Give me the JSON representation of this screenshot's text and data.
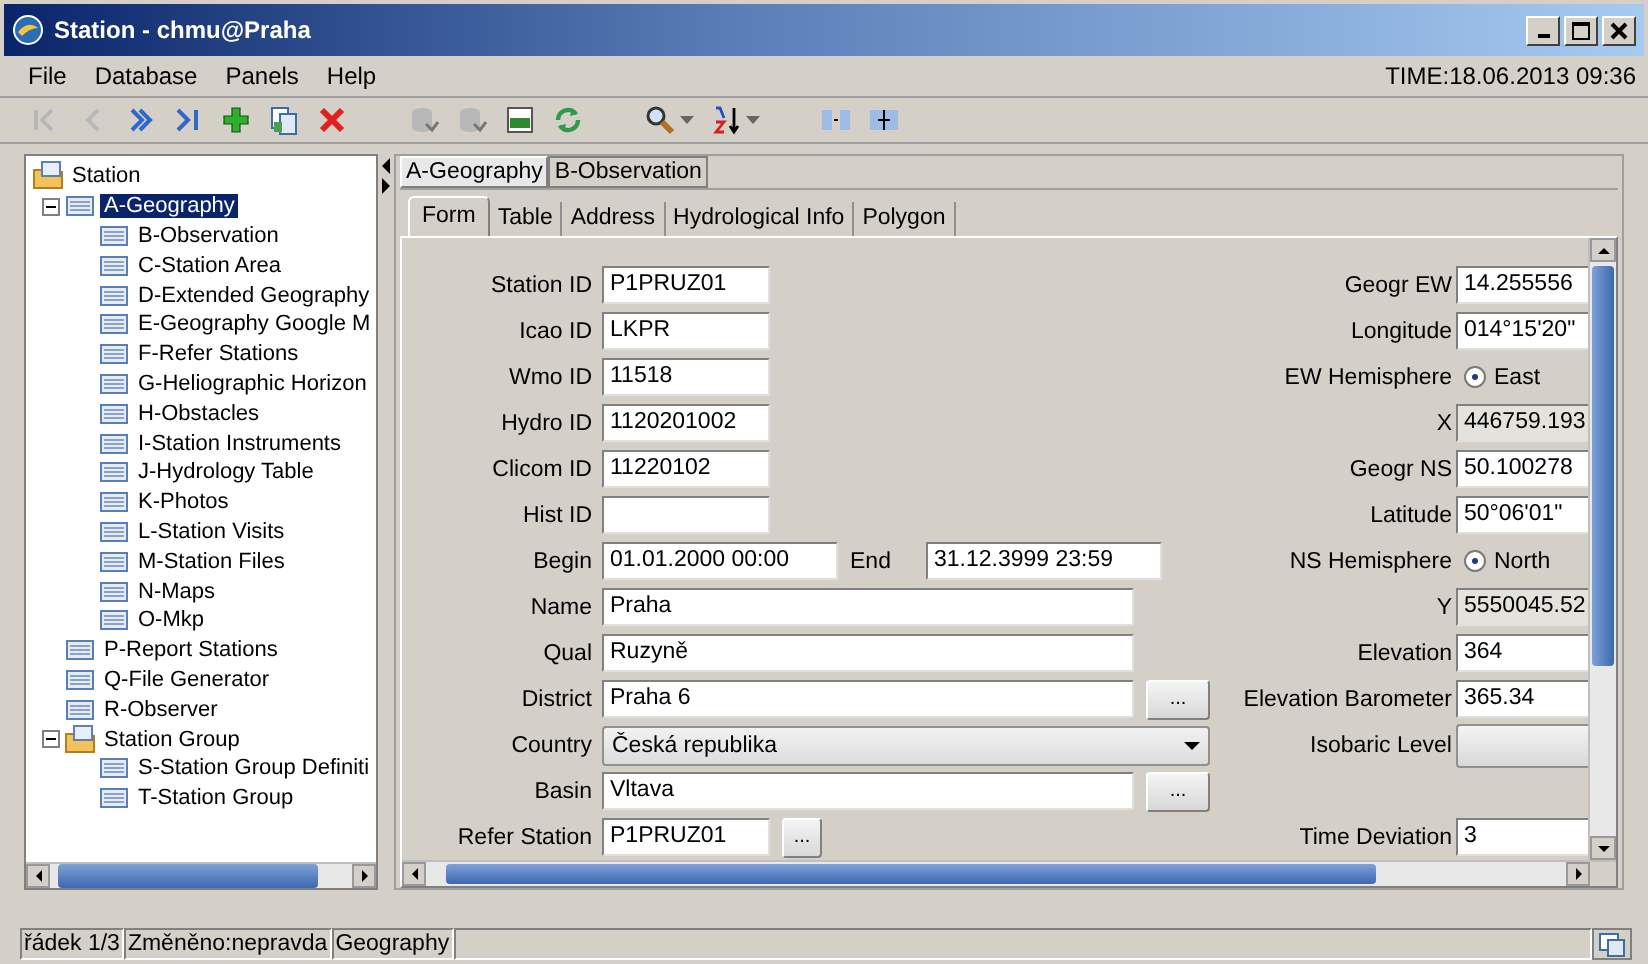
{
  "window": {
    "title": "Station - chmu@Praha"
  },
  "menu": [
    "File",
    "Database",
    "Panels",
    "Help"
  ],
  "time": "TIME:18.06.2013 09:36",
  "toolbar": [
    {
      "kind": "first",
      "disabled": true
    },
    {
      "kind": "prev",
      "disabled": true
    },
    {
      "kind": "next",
      "disabled": false
    },
    {
      "kind": "last",
      "disabled": false
    },
    {
      "kind": "add",
      "disabled": false
    },
    {
      "kind": "copy",
      "disabled": false
    },
    {
      "kind": "delete",
      "disabled": false
    },
    {
      "kind": "sep"
    },
    {
      "kind": "db",
      "disabled": true
    },
    {
      "kind": "db",
      "disabled": true
    },
    {
      "kind": "csv",
      "disabled": false
    },
    {
      "kind": "refresh",
      "disabled": false
    },
    {
      "kind": "sep"
    },
    {
      "kind": "search",
      "disabled": false
    },
    {
      "kind": "sort",
      "disabled": false
    },
    {
      "kind": "sep"
    },
    {
      "kind": "split",
      "disabled": false
    },
    {
      "kind": "join",
      "disabled": false
    }
  ],
  "tree": [
    {
      "label": "Station",
      "kind": "folder",
      "selected": false,
      "children": [
        {
          "label": "A-Geography",
          "kind": "table",
          "selected": true,
          "expanded": true,
          "children": [
            {
              "label": "B-Observation",
              "kind": "table",
              "selected": false
            },
            {
              "label": "C-Station Area",
              "kind": "table",
              "selected": false
            },
            {
              "label": "D-Extended Geography",
              "kind": "table",
              "selected": false
            },
            {
              "label": "E-Geography Google M",
              "kind": "table",
              "selected": false
            },
            {
              "label": "F-Refer Stations",
              "kind": "table",
              "selected": false
            },
            {
              "label": "G-Heliographic Horizon",
              "kind": "table",
              "selected": false
            },
            {
              "label": "H-Obstacles",
              "kind": "table",
              "selected": false
            },
            {
              "label": "I-Station Instruments",
              "kind": "table",
              "selected": false
            },
            {
              "label": "J-Hydrology Table",
              "kind": "table",
              "selected": false
            },
            {
              "label": "K-Photos",
              "kind": "table",
              "selected": false
            },
            {
              "label": "L-Station Visits",
              "kind": "table",
              "selected": false
            },
            {
              "label": "M-Station Files",
              "kind": "table",
              "selected": false
            },
            {
              "label": "N-Maps",
              "kind": "table",
              "selected": false
            },
            {
              "label": "O-Mkp",
              "kind": "table",
              "selected": false
            }
          ]
        },
        {
          "label": "P-Report Stations",
          "kind": "table",
          "selected": false
        },
        {
          "label": "Q-File Generator",
          "kind": "table",
          "selected": false
        },
        {
          "label": "R-Observer",
          "kind": "table",
          "selected": false
        },
        {
          "label": "Station Group",
          "kind": "folder",
          "selected": false,
          "expanded": true,
          "children": [
            {
              "label": "S-Station Group Definiti",
              "kind": "table",
              "selected": false
            },
            {
              "label": "T-Station Group",
              "kind": "table",
              "selected": false
            }
          ]
        }
      ]
    }
  ],
  "panel_tabs": [
    {
      "label": "A-Geography",
      "selected": true
    },
    {
      "label": "B-Observation",
      "selected": false
    }
  ],
  "form_tabs": [
    {
      "label": "Form",
      "selected": true
    },
    {
      "label": "Table",
      "selected": false
    },
    {
      "label": "Address",
      "selected": false
    },
    {
      "label": "Hydrological Info",
      "selected": false
    },
    {
      "label": "Polygon",
      "selected": false
    }
  ],
  "form_left": [
    {
      "kind": "short",
      "label": "Station ID",
      "value": "P1PRUZ01"
    },
    {
      "kind": "short",
      "label": "Icao ID",
      "value": "LKPR"
    },
    {
      "kind": "short",
      "label": "Wmo ID",
      "value": "11518"
    },
    {
      "kind": "short",
      "label": "Hydro ID",
      "value": "1120201002"
    },
    {
      "kind": "short",
      "label": "Clicom ID",
      "value": "11220102"
    },
    {
      "kind": "short",
      "label": "Hist ID"
    },
    {
      "kind": "range",
      "label": "Begin",
      "value": "01.01.2000 00:00",
      "label2": "End",
      "value2": "31.12.3999 23:59"
    },
    {
      "kind": "long",
      "label": "Name",
      "value": "Praha"
    },
    {
      "kind": "long",
      "label": "Qual",
      "value": "Ruzyně"
    },
    {
      "kind": "long",
      "label": "District",
      "value": "Praha 6",
      "button": "..."
    },
    {
      "kind": "select",
      "label": "Country",
      "value": "Česká republika"
    },
    {
      "kind": "long",
      "label": "Basin",
      "value": "Vltava",
      "button": "..."
    },
    {
      "kind": "short",
      "label": "Refer Station",
      "value": "P1PRUZ01",
      "button": "..."
    }
  ],
  "form_right": [
    {
      "kind": "text",
      "label": "Geogr EW",
      "value": "14.255556"
    },
    {
      "kind": "text",
      "label": "Longitude",
      "value": "014°15'20\""
    },
    {
      "kind": "radio",
      "label": "EW Hemisphere",
      "option": "East",
      "selected": true
    },
    {
      "kind": "readonly",
      "label": "X",
      "value": "446759.193"
    },
    {
      "kind": "text",
      "label": "Geogr NS",
      "value": "50.100278"
    },
    {
      "kind": "text",
      "label": "Latitude",
      "value": "50°06'01\""
    },
    {
      "kind": "radio",
      "label": "NS Hemisphere",
      "option": "North",
      "selected": true
    },
    {
      "kind": "readonly",
      "label": "Y",
      "value": "5550045.52"
    },
    {
      "kind": "text",
      "label": "Elevation",
      "value": "364"
    },
    {
      "kind": "text",
      "label": "Elevation Barometer",
      "value": "365.34"
    },
    {
      "kind": "button",
      "label": "Isobaric Level"
    },
    {
      "kind": "text",
      "label": "Time Deviation",
      "value": "3",
      "gap_before": true
    }
  ],
  "status_bar": [
    "řádek 1/3",
    "Změněno:nepravda",
    "Geography"
  ]
}
